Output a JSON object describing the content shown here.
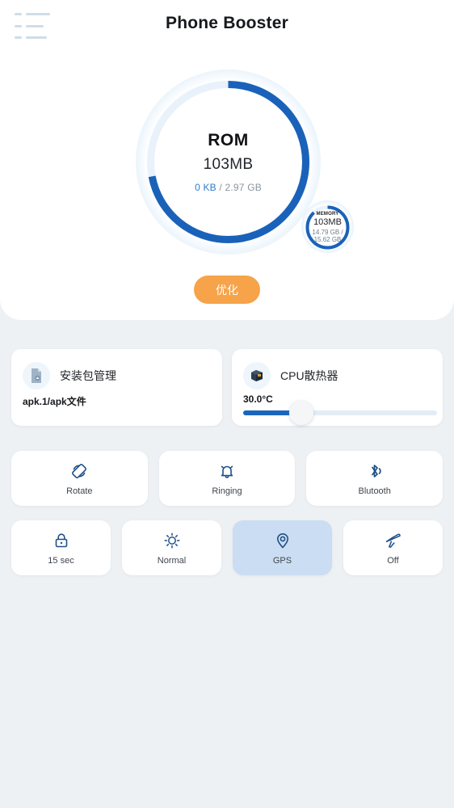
{
  "header": {
    "title": "Phone Booster",
    "menu_icon": "hamburger-menu-icon"
  },
  "storage_gauge": {
    "label": "ROM",
    "value": "103MB",
    "used": "0 KB",
    "separator": " / ",
    "total": "2.97 GB",
    "percent": 72,
    "arc_color": "#1a62b9",
    "track_color": "#e9f2fa"
  },
  "memory_gauge": {
    "label": "MEMORY",
    "value": "103MB",
    "used": "14.79 GB /",
    "total": "15.62 GB",
    "percent": 88,
    "arc_color": "#1a62b9"
  },
  "optimize": {
    "label": "优化",
    "color": "#f6a34a"
  },
  "cards": [
    {
      "icon": "apk-file-icon",
      "title": "安装包管理",
      "footer": "apk.1/apk文件"
    },
    {
      "icon": "cpu-chip-icon",
      "title": "CPU散热器",
      "temperature": "30.0°C",
      "slider_percent": 30,
      "slider_fill_color": "#1a66bd"
    }
  ],
  "tiles_row1": [
    {
      "icon": "screen-rotate-icon",
      "label": "Rotate",
      "active": false
    },
    {
      "icon": "bell-ringing-icon",
      "label": "Ringing",
      "active": false
    },
    {
      "icon": "bluetooth-icon",
      "label": "Blutooth",
      "active": false
    }
  ],
  "tiles_row2": [
    {
      "icon": "lock-icon",
      "label": "15 sec",
      "active": false
    },
    {
      "icon": "brightness-sun-icon",
      "label": "Normal",
      "active": false
    },
    {
      "icon": "gps-location-pin-icon",
      "label": "GPS",
      "active": true
    },
    {
      "icon": "airplane-mode-icon",
      "label": "Off",
      "active": false
    }
  ]
}
